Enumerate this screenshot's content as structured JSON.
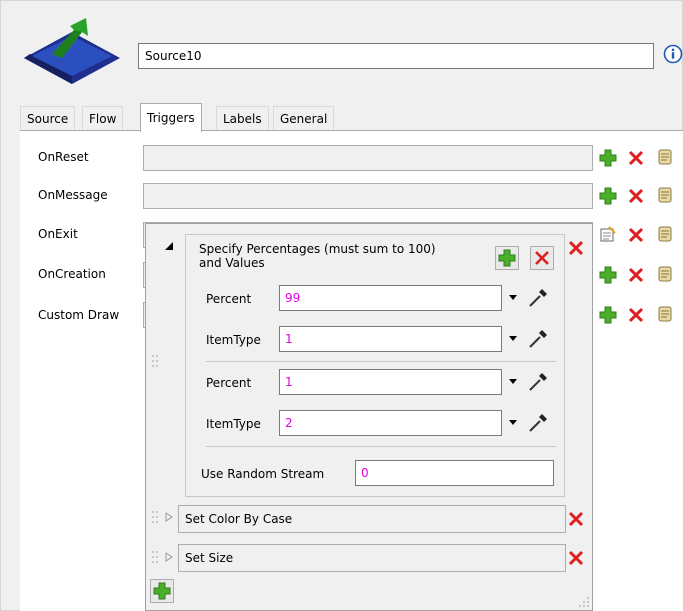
{
  "object_name": "Source10",
  "tabs": [
    {
      "label": "Source"
    },
    {
      "label": "Flow"
    },
    {
      "label": "Triggers"
    },
    {
      "label": "Labels"
    },
    {
      "label": "General"
    }
  ],
  "triggers": [
    {
      "label": "OnReset"
    },
    {
      "label": "OnMessage"
    },
    {
      "label": "OnExit"
    },
    {
      "label": "OnCreation"
    },
    {
      "label": "Custom Draw"
    }
  ],
  "popup": {
    "title": "Specify Percentages (must sum to 100) and Values",
    "entries": [
      {
        "percent_label": "Percent",
        "percent_value": "99",
        "itemtype_label": "ItemType",
        "itemtype_value": "1"
      },
      {
        "percent_label": "Percent",
        "percent_value": "1",
        "itemtype_label": "ItemType",
        "itemtype_value": "2"
      }
    ],
    "random_stream_label": "Use Random Stream",
    "random_stream_value": "0",
    "collapsed_items": [
      {
        "label": "Set Color By Case"
      },
      {
        "label": "Set Size"
      }
    ]
  },
  "colors": {
    "add": "#4caf2a",
    "remove": "#e02020",
    "value_text": "#e000e0"
  }
}
